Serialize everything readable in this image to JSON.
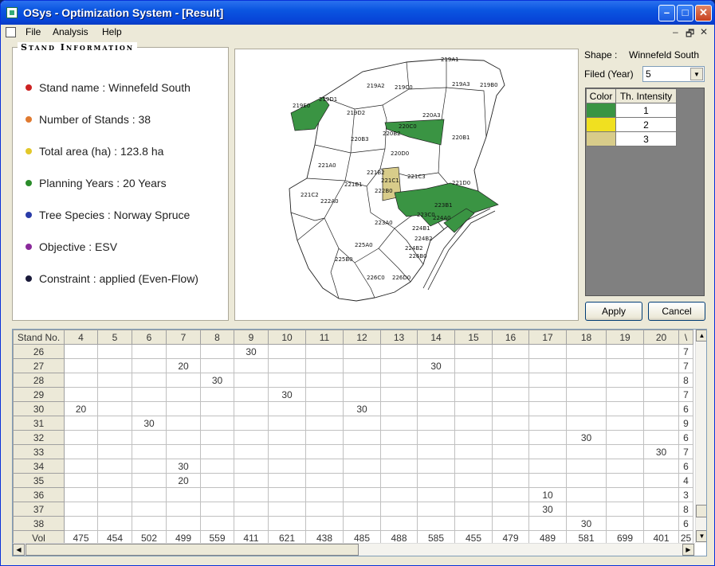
{
  "window": {
    "title": "OSys - Optimization System - [Result]"
  },
  "menu": {
    "items": [
      "File",
      "Analysis",
      "Help"
    ],
    "mdi_controls": [
      "–",
      "🗗",
      "✕"
    ]
  },
  "stand_info": {
    "legend": "Stand Information",
    "rows": [
      {
        "text": "Stand name : Winnefeld South",
        "color": "#cc2222"
      },
      {
        "text": "Number of Stands : 38",
        "color": "#e07a30"
      },
      {
        "text": "Total area (ha) : 123.8 ha",
        "color": "#e2c82a"
      },
      {
        "text": "Planning Years : 20 Years",
        "color": "#2a8c2a"
      },
      {
        "text": "Tree Species : Norway Spruce",
        "color": "#2a3ca8"
      },
      {
        "text": "Objective : ESV",
        "color": "#8a2a9a"
      },
      {
        "text": "Constraint : applied (Even-Flow)",
        "color": "#1a1a3a"
      }
    ]
  },
  "map": {
    "labels": [
      "219A1",
      "219A2",
      "219C0",
      "219A3",
      "219B0",
      "219E0",
      "219D1",
      "219D2",
      "220A3",
      "220C0",
      "220B2",
      "220B3",
      "220B1",
      "220D0",
      "221A0",
      "221B2",
      "221C1",
      "221C3",
      "221D0",
      "221B1",
      "222B0",
      "221C2",
      "222A0",
      "223B1",
      "223C0",
      "223A0",
      "224A0",
      "224B2",
      "224B1",
      "224B2",
      "225A0",
      "225B0",
      "226B0",
      "226C0",
      "226D0"
    ],
    "colors": {
      "green": "#3a9443",
      "tan": "#d8cc8a"
    }
  },
  "shape": {
    "label": "Shape :",
    "value": "Winnefeld South"
  },
  "filed": {
    "label": "Filed (Year)",
    "value": "5"
  },
  "legend_table": {
    "headers": [
      "Color",
      "Th. Intensity"
    ],
    "rows": [
      {
        "color": "#3a9443",
        "value": "1"
      },
      {
        "color": "#f0e020",
        "value": "2"
      },
      {
        "color": "#d8cc8a",
        "value": "3"
      }
    ]
  },
  "buttons": {
    "apply": "Apply",
    "cancel": "Cancel"
  },
  "grid": {
    "columns": [
      "Stand No.",
      "4",
      "5",
      "6",
      "7",
      "8",
      "9",
      "10",
      "11",
      "12",
      "13",
      "14",
      "15",
      "16",
      "17",
      "18",
      "19",
      "20",
      "\\"
    ],
    "rows": [
      [
        "26",
        "",
        "",
        "",
        "",
        "",
        "30",
        "",
        "",
        "",
        "",
        "",
        "",
        "",
        "",
        "",
        "",
        "",
        "7"
      ],
      [
        "27",
        "",
        "",
        "",
        "20",
        "",
        "",
        "",
        "",
        "",
        "",
        "30",
        "",
        "",
        "",
        "",
        "",
        "",
        "7"
      ],
      [
        "28",
        "",
        "",
        "",
        "",
        "30",
        "",
        "",
        "",
        "",
        "",
        "",
        "",
        "",
        "",
        "",
        "",
        "",
        "8"
      ],
      [
        "29",
        "",
        "",
        "",
        "",
        "",
        "",
        "30",
        "",
        "",
        "",
        "",
        "",
        "",
        "",
        "",
        "",
        "",
        "7"
      ],
      [
        "30",
        "20",
        "",
        "",
        "",
        "",
        "",
        "",
        "",
        "30",
        "",
        "",
        "",
        "",
        "",
        "",
        "",
        "",
        "6"
      ],
      [
        "31",
        "",
        "",
        "30",
        "",
        "",
        "",
        "",
        "",
        "",
        "",
        "",
        "",
        "",
        "",
        "",
        "",
        "",
        "9"
      ],
      [
        "32",
        "",
        "",
        "",
        "",
        "",
        "",
        "",
        "",
        "",
        "",
        "",
        "",
        "",
        "",
        "30",
        "",
        "",
        "6"
      ],
      [
        "33",
        "",
        "",
        "",
        "",
        "",
        "",
        "",
        "",
        "",
        "",
        "",
        "",
        "",
        "",
        "",
        "",
        "30",
        "7"
      ],
      [
        "34",
        "",
        "",
        "",
        "30",
        "",
        "",
        "",
        "",
        "",
        "",
        "",
        "",
        "",
        "",
        "",
        "",
        "",
        "6"
      ],
      [
        "35",
        "",
        "",
        "",
        "20",
        "",
        "",
        "",
        "",
        "",
        "",
        "",
        "",
        "",
        "",
        "",
        "",
        "",
        "4"
      ],
      [
        "36",
        "",
        "",
        "",
        "",
        "",
        "",
        "",
        "",
        "",
        "",
        "",
        "",
        "",
        "10",
        "",
        "",
        "",
        "3"
      ],
      [
        "37",
        "",
        "",
        "",
        "",
        "",
        "",
        "",
        "",
        "",
        "",
        "",
        "",
        "",
        "30",
        "",
        "",
        "",
        "8"
      ],
      [
        "38",
        "",
        "",
        "",
        "",
        "",
        "",
        "",
        "",
        "",
        "",
        "",
        "",
        "",
        "",
        "30",
        "",
        "",
        "6"
      ],
      [
        "Vol",
        "475",
        "454",
        "502",
        "499",
        "559",
        "411",
        "621",
        "438",
        "485",
        "488",
        "585",
        "455",
        "479",
        "489",
        "581",
        "699",
        "401",
        "25"
      ]
    ]
  }
}
